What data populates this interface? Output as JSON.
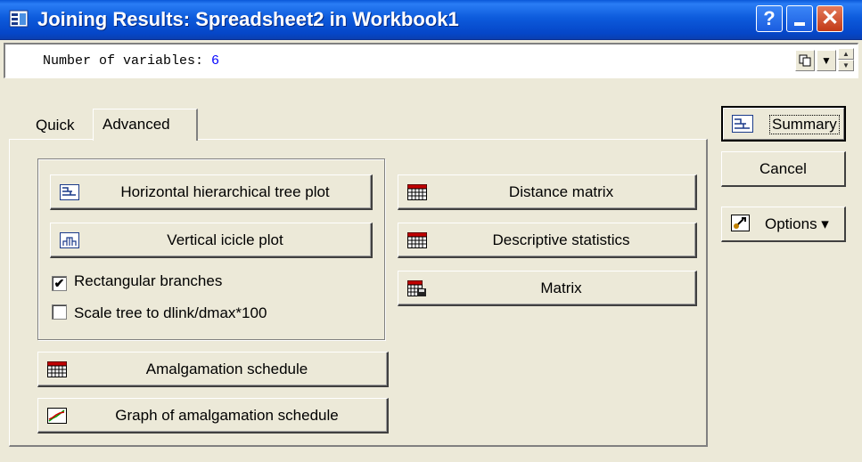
{
  "window": {
    "title": "Joining Results: Spreadsheet2 in Workbook1",
    "help_label": "?",
    "close_label": "✕"
  },
  "infobar": {
    "label": "Number of variables:",
    "value": "6"
  },
  "tabs": [
    {
      "label": "Quick",
      "active": false
    },
    {
      "label": "Advanced",
      "active": true
    }
  ],
  "buttons": {
    "horizontal_tree": "Horizontal hierarchical tree plot",
    "vertical_icicle": "Vertical icicle plot",
    "amalgamation_schedule": "Amalgamation schedule",
    "graph_amalgamation": "Graph of amalgamation schedule",
    "distance_matrix": "Distance matrix",
    "descriptive_statistics": "Descriptive statistics",
    "matrix": "Matrix"
  },
  "checkboxes": {
    "rectangular_branches": {
      "label": "Rectangular branches",
      "checked": true
    },
    "scale_tree": {
      "label": "Scale tree to dlink/dmax*100",
      "checked": false
    }
  },
  "side": {
    "summary": "Summary",
    "cancel": "Cancel",
    "options": "Options ▾"
  },
  "colors": {
    "titlebar": "#0a57d8",
    "face": "#ece9d8",
    "value": "#0000ff"
  }
}
